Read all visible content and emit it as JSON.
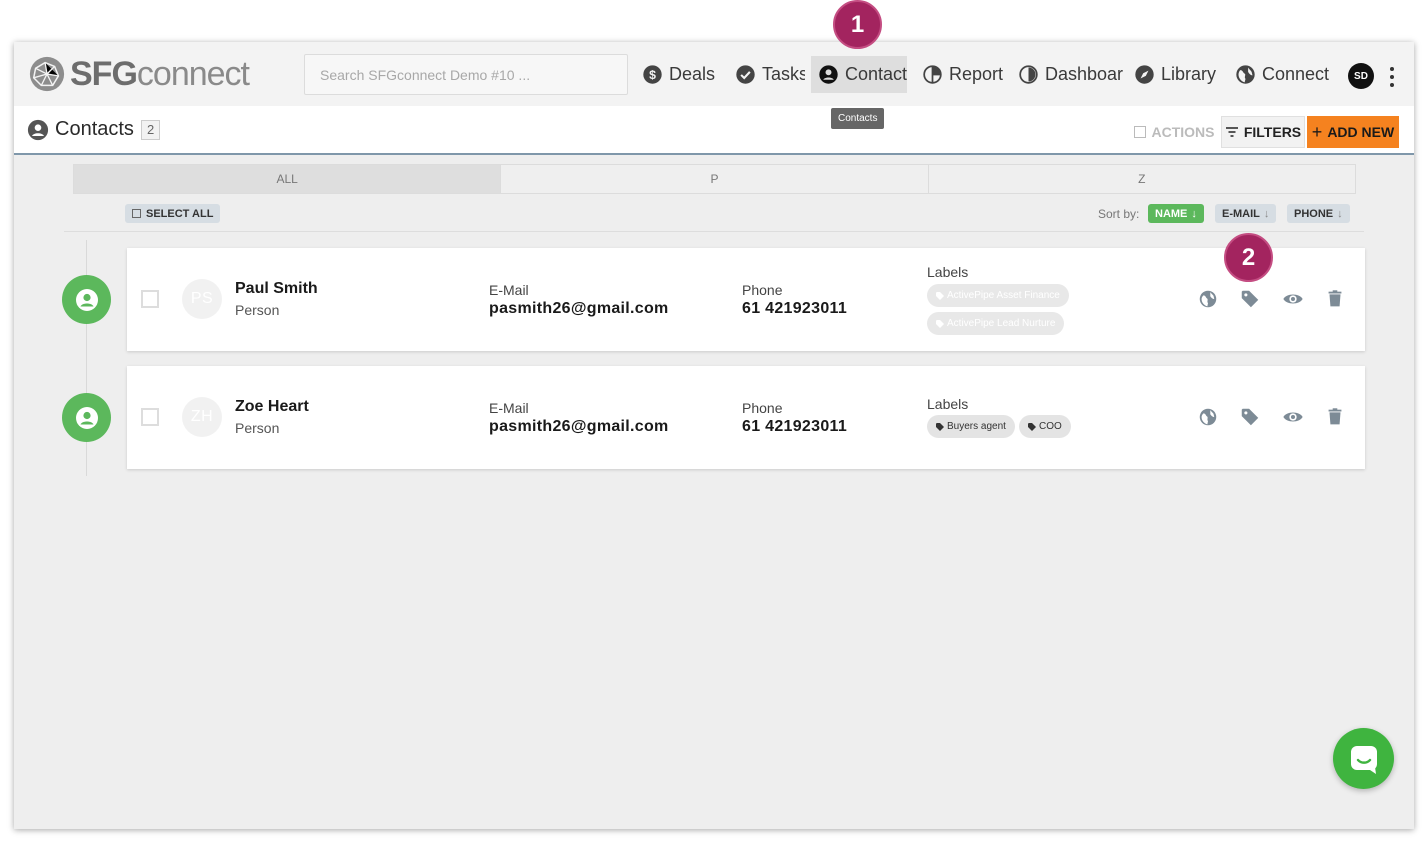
{
  "logo": {
    "part1": "SFG",
    "part2": "connect"
  },
  "search": {
    "placeholder": "Search SFGconnect Demo #10 ..."
  },
  "nav": {
    "deals": "Deals",
    "tasks": "Tasks",
    "contacts": "Contact",
    "reports": "Report:",
    "dashboard": "Dashboar",
    "library": "Library",
    "connect": "Connect"
  },
  "user": {
    "initials": "SD"
  },
  "tooltip": "Contacts",
  "header": {
    "title": "Contacts",
    "count": "2",
    "actions_label": "ACTIONS",
    "filters_label": "FILTERS",
    "add_new_label": "ADD NEW"
  },
  "tabs": [
    "ALL",
    "P",
    "Z"
  ],
  "list_controls": {
    "select_all": "SELECT ALL",
    "sort_by_label": "Sort by:",
    "sort_name": "NAME",
    "sort_email": "E-MAIL",
    "sort_phone": "PHONE",
    "arrow": "↓"
  },
  "contacts": [
    {
      "initials": "PS",
      "name": "Paul Smith",
      "type": "Person",
      "email_label": "E-Mail",
      "email": "pasmith26@gmail.com",
      "phone_label": "Phone",
      "phone": "61 421923011",
      "labels_title": "Labels",
      "labels": [
        "ActivePipe Asset Finance",
        "ActivePipe Lead Nurture"
      ]
    },
    {
      "initials": "ZH",
      "name": "Zoe Heart",
      "type": "Person",
      "email_label": "E-Mail",
      "email": "pasmith26@gmail.com",
      "phone_label": "Phone",
      "phone": "61 421923011",
      "labels_title": "Labels",
      "labels": [
        "Buyers agent",
        "COO"
      ]
    }
  ],
  "callouts": [
    "1",
    "2"
  ],
  "colors": {
    "accent_green": "#5cb85c",
    "add_button_orange": "#f5821f",
    "callout_magenta": "#a3245f",
    "chat_green": "#3fb43f"
  },
  "icons": [
    "globe-icon",
    "tag-icon",
    "eye-icon",
    "trash-icon",
    "dollar-icon",
    "check-circle-icon",
    "person-circle-icon",
    "pie-chart-icon",
    "dashboard-gauge-icon",
    "compass-icon",
    "filter-icon",
    "chat-icon"
  ]
}
